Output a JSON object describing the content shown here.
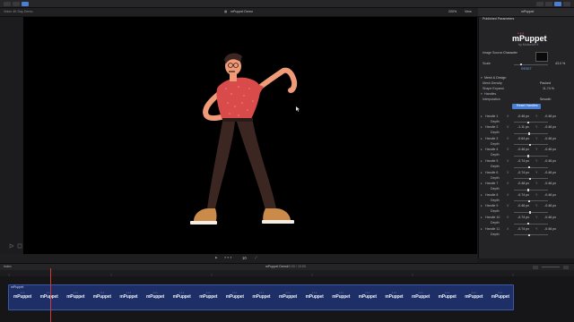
{
  "window": {
    "title": "mPuppet Demo",
    "library": "Video 4K Day Demo",
    "zoom": "200%",
    "view_label": "View"
  },
  "inspector": {
    "tab": "mPuppet",
    "header": "Published Parameters",
    "logo": "mPuppet",
    "logo_sub": "by MotionVFX",
    "image_source_label": "Image Source",
    "image_source_value": "Character",
    "scale_label": "Scale",
    "scale_value": "43.0 %",
    "reset_label": "RESET",
    "mesh_section": "Mesh & Design",
    "mesh_density_label": "Mesh Density",
    "mesh_density_value": "Packed",
    "shape_expand_label": "Shape Expand",
    "shape_expand_value": "11.74 %",
    "handles_label": "Handles",
    "interpolation_label": "Interpolation",
    "interpolation_value": "Smooth",
    "reset_handles_label": "Reset Handles",
    "handles": [
      {
        "name": "Handle 1",
        "x": "-0.46 px",
        "y": "-0.46 px"
      },
      {
        "name": "Handle 2",
        "x": "-1.11 px",
        "y": "-0.46 px"
      },
      {
        "name": "Handle 3",
        "x": "-0.64 px",
        "y": "-0.46 px"
      },
      {
        "name": "Handle 4",
        "x": "-0.46 px",
        "y": "-0.46 px"
      },
      {
        "name": "Handle 5",
        "x": "-0.74 px",
        "y": "-0.46 px"
      },
      {
        "name": "Handle 6",
        "x": "-0.74 px",
        "y": "-0.46 px"
      },
      {
        "name": "Handle 7",
        "x": "-0.48 px",
        "y": "-0.46 px"
      },
      {
        "name": "Handle 8",
        "x": "-0.74 px",
        "y": "-0.46 px"
      },
      {
        "name": "Handle 9",
        "x": "-0.46 px",
        "y": "-0.46 px"
      },
      {
        "name": "Handle 10",
        "x": "-0.74 px",
        "y": "-0.46 px"
      },
      {
        "name": "Handle 11",
        "x": "-0.74 px",
        "y": "-0.46 px"
      }
    ],
    "depth_label": "Depth"
  },
  "transport": {
    "timecode": "10"
  },
  "timeline": {
    "index_label": "Index",
    "project": "mPuppet Demo",
    "duration": "00:00 / 10:00",
    "clip_label": "mPuppet"
  },
  "colors": {
    "accent": "#4a7fd6",
    "clip": "#1d2f66",
    "playhead": "#d23b3b",
    "shirt": "#d94a4a",
    "skin": "#f09a78",
    "pants": "#3b2622",
    "shoe": "#c98a4a"
  }
}
